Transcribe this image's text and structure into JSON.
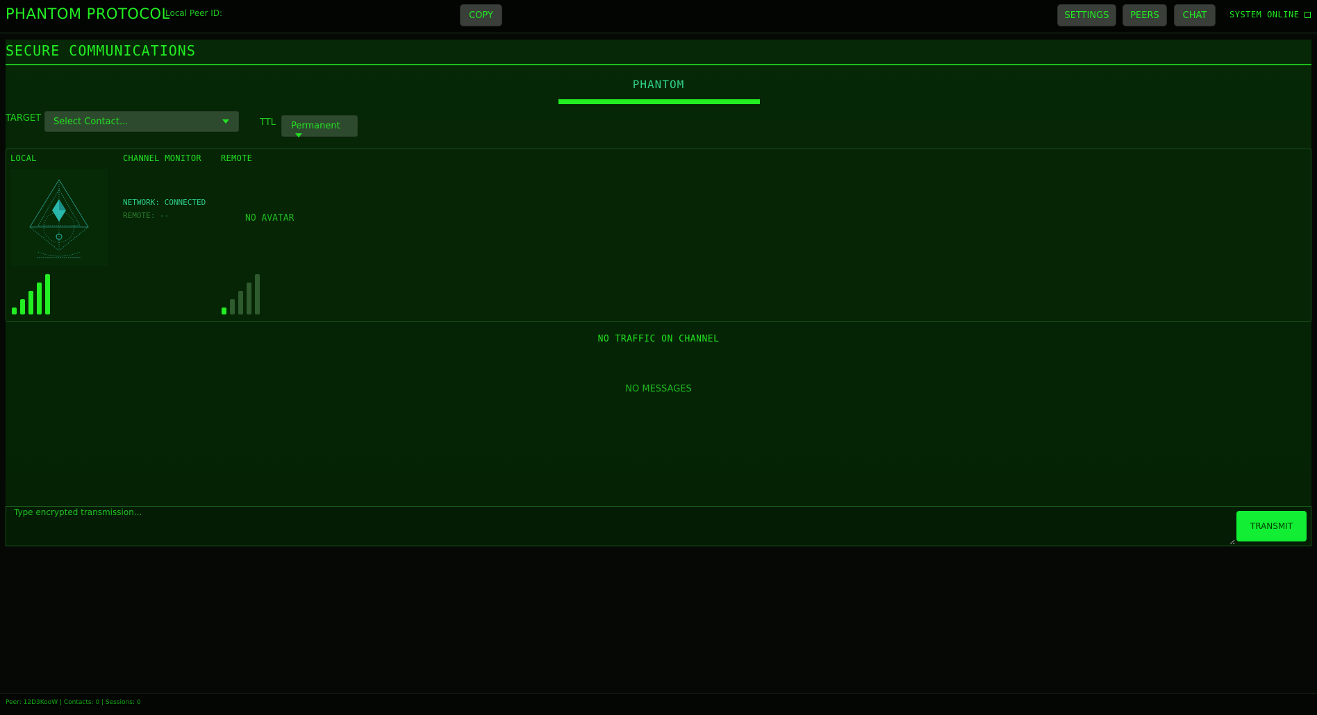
{
  "header": {
    "app_title": "PHANTOM PROTOCOL",
    "peer_id_label": "Local Peer ID:",
    "copy_label": "COPY",
    "nav": {
      "settings": "SETTINGS",
      "peers": "PEERS",
      "chat": "CHAT"
    },
    "system_status": "SYSTEM ONLINE"
  },
  "main": {
    "section_title": "SECURE COMMUNICATIONS",
    "brand": "PHANTOM",
    "target_label": "TARGET",
    "contact_placeholder": "Select Contact...",
    "ttl_label": "TTL",
    "ttl_value": "Permanent",
    "monitor": {
      "local_label": "LOCAL",
      "channel_label": "CHANNEL MONITOR",
      "remote_label": "REMOTE",
      "network_status": "NETWORK: CONNECTED",
      "remote_status": "REMOTE: --",
      "no_avatar": "NO AVATAR",
      "local_signal_level": 5,
      "remote_signal_level": 1,
      "signal_max": 5
    },
    "no_traffic": "NO TRAFFIC ON CHANNEL",
    "no_messages": "NO MESSAGES"
  },
  "composer": {
    "placeholder": "Type encrypted transmission...",
    "transmit_label": "TRANSMIT"
  },
  "footer": {
    "status": "Peer: 12D3KooW | Contacts: 0 | Sessions: 0"
  },
  "colors": {
    "accent": "#22ee22",
    "dim": "#2e5a2e",
    "teal": "#2fd0c8"
  }
}
